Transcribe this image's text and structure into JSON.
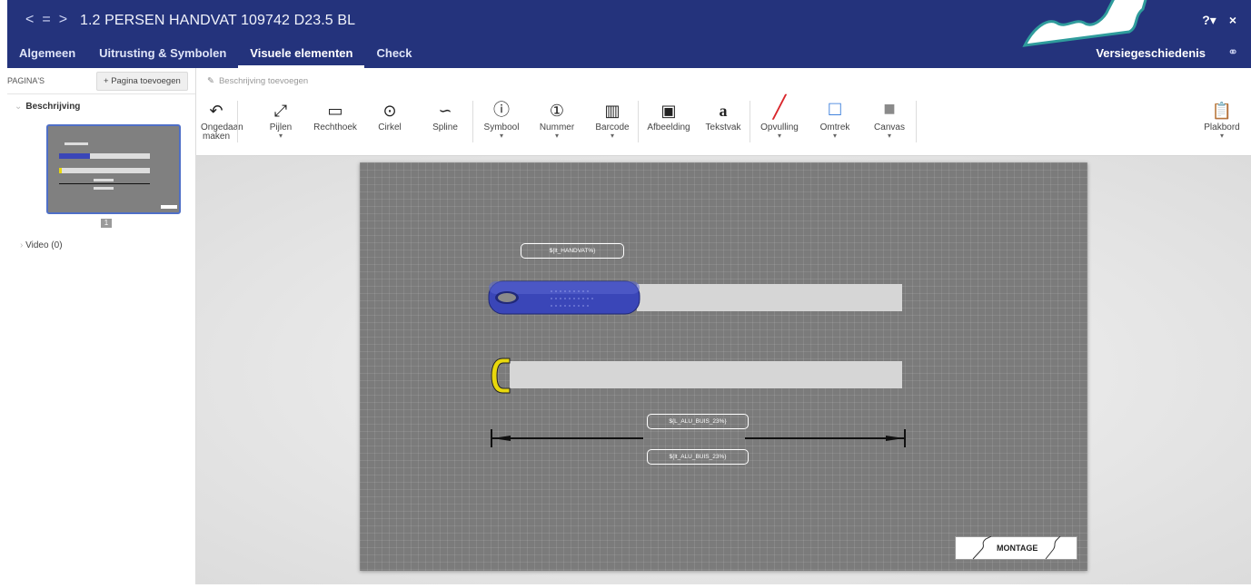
{
  "header": {
    "nav": [
      "<",
      "=",
      ">"
    ],
    "title": "1.2  PERSEN HANDVAT 109742 D23.5 BL",
    "help_icon": "question-circle-icon",
    "close_label": "×",
    "tabs": [
      {
        "label": "Algemeen"
      },
      {
        "label": "Uitrusting & Symbolen"
      },
      {
        "label": "Visuele elementen",
        "active": true
      },
      {
        "label": "Check"
      }
    ],
    "version_history": "Versiegeschiedenis",
    "accent_color": "#24337c"
  },
  "pages_panel": {
    "label": "PAGINA'S",
    "add_page": "Pagina toevoegen",
    "section": "Beschrijving",
    "page_number": "1",
    "video": "Video (0)"
  },
  "description_bar": {
    "placeholder": "Beschrijving toevoegen"
  },
  "toolbar": {
    "undo": "Ongedaan maken",
    "arrows": "Pijlen",
    "rectangle": "Rechthoek",
    "circle": "Cirkel",
    "spline": "Spline",
    "symbol": "Symbool",
    "number": "Nummer",
    "barcode": "Barcode",
    "image": "Afbeelding",
    "textbox": "Tekstvak",
    "fill": "Opvulling",
    "stroke": "Omtrek",
    "canvas": "Canvas",
    "clipboard": "Plakbord",
    "textbox_glyph": "a"
  },
  "canvas": {
    "label_handvat": "${lt_HANDVAT%}",
    "label_alu_1": "${L_ALU_BUIS_23%}",
    "label_alu_2": "${lt_ALU_BUIS_23%}",
    "montage": "MONTAGE",
    "colors": {
      "handle": "#3a46b8",
      "cap": "#e8d80c",
      "tube": "#d6d6d6",
      "canvas": "#7b7b7b"
    }
  }
}
